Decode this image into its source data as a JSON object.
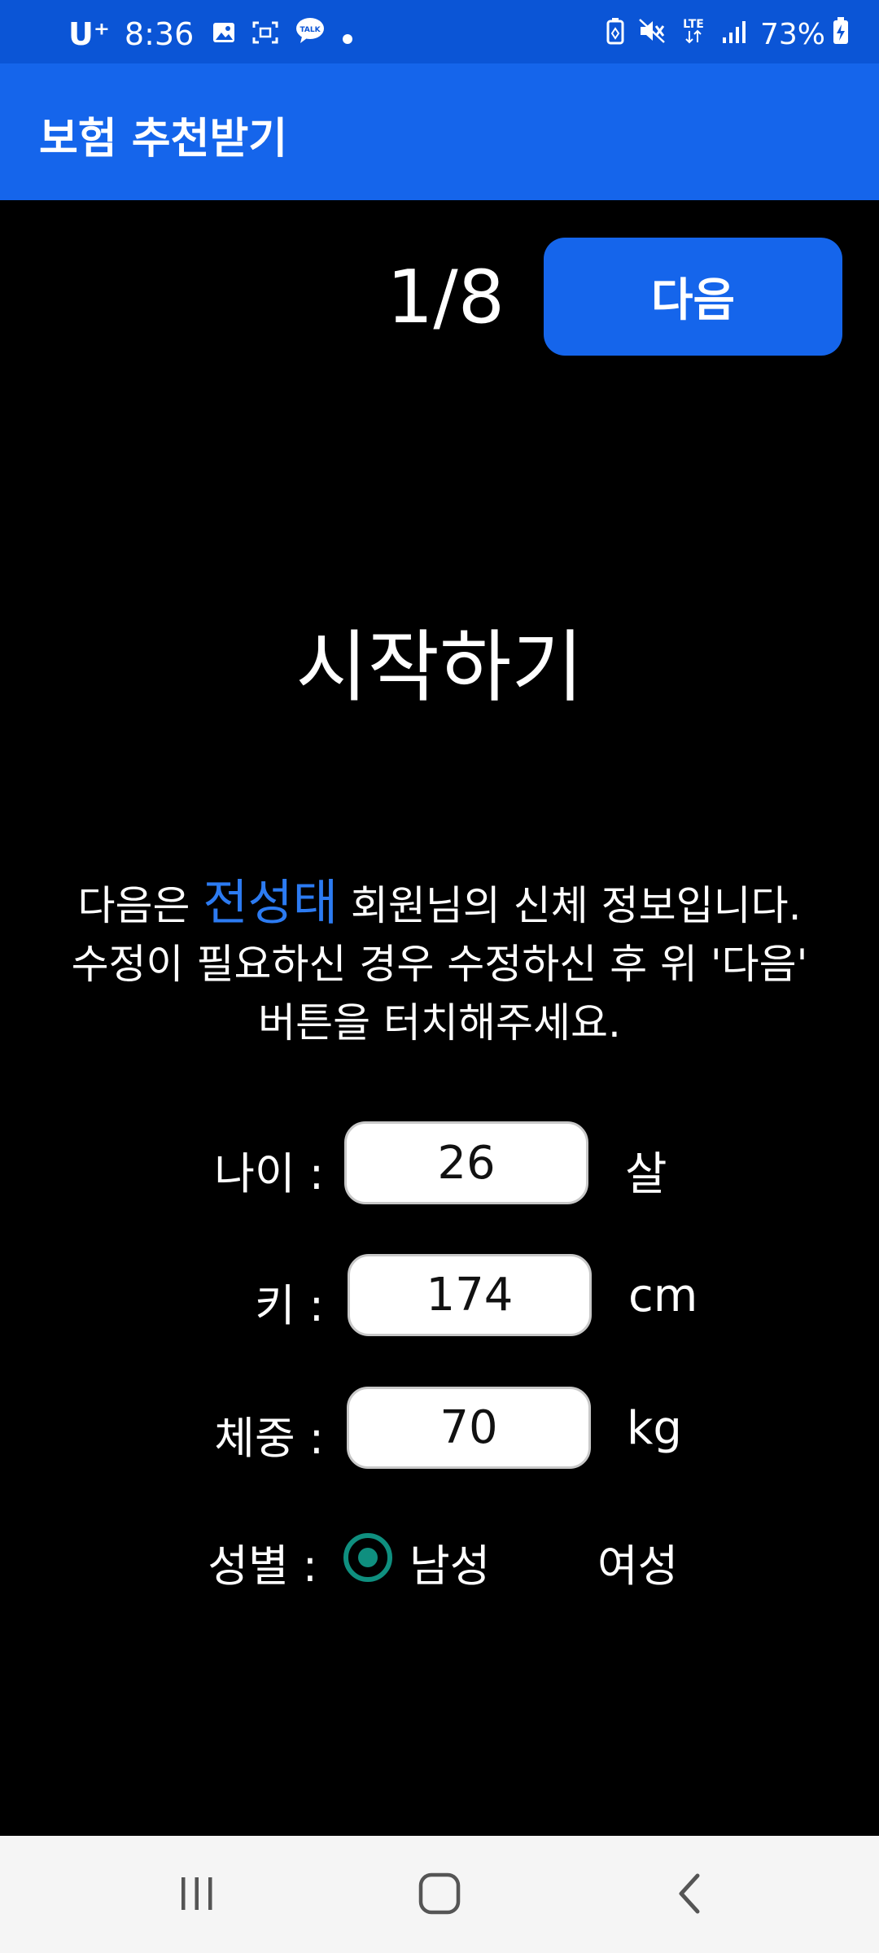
{
  "status_bar": {
    "carrier": "U⁺",
    "time": "8:36",
    "battery": "73%",
    "network": "LTE",
    "icons_left": [
      "gallery-icon",
      "screenshot-icon",
      "talk-icon",
      "dot-icon"
    ],
    "icons_right": [
      "battery-saver-icon",
      "mute-icon",
      "lte-icon",
      "signal-icon",
      "battery-icon"
    ]
  },
  "app_bar": {
    "title": "보험 추천받기"
  },
  "wizard": {
    "step": "1/8",
    "next_label": "다음"
  },
  "heading": "시작하기",
  "description": {
    "prefix": "다음은 ",
    "member_name": "전성태",
    "line1_suffix": " 회원님의 신체 정보입니다.",
    "line2": "수정이 필요하신 경우 수정하신 후 위 '다음'",
    "line3": "버튼을 터치해주세요."
  },
  "form": {
    "age": {
      "label": "나이 :",
      "value": "26",
      "unit": "살"
    },
    "height": {
      "label": "키 :",
      "value": "174",
      "unit": "cm"
    },
    "weight": {
      "label": "체중 :",
      "value": "70",
      "unit": "kg"
    },
    "gender": {
      "label": "성별 :",
      "options": [
        "남성",
        "여성"
      ],
      "selected": "남성"
    }
  },
  "colors": {
    "status_bar": "#0b55d6",
    "app_bar": "#1565eb",
    "accent": "#1565eb",
    "member_name": "#2c7bf2",
    "radio": "#0f8f7f",
    "background": "#000000"
  },
  "nav_bar": {
    "buttons": [
      "recents-icon",
      "home-icon",
      "back-icon"
    ]
  }
}
